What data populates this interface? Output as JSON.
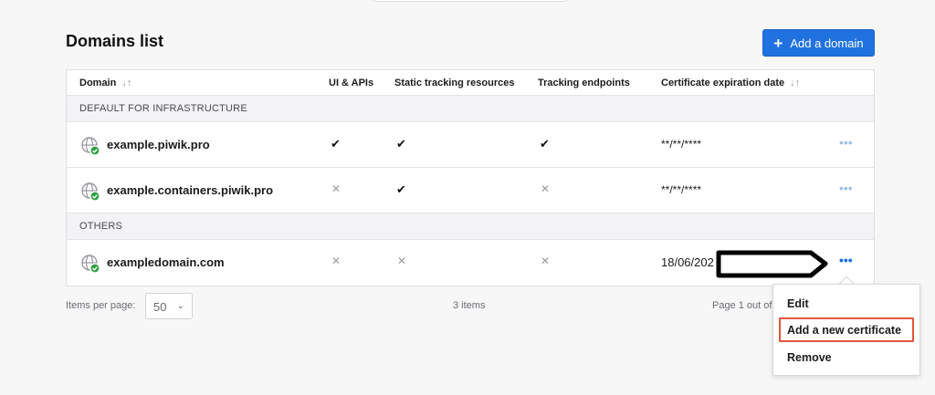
{
  "page": {
    "title": "Domains list"
  },
  "actions": {
    "add_domain_label": "Add a domain",
    "add_icon": "plus-icon"
  },
  "table": {
    "headers": {
      "domain": "Domain",
      "ui_apis": "UI & APIs",
      "static_tracking": "Static tracking resources",
      "tracking_endpoints": "Tracking endpoints",
      "cert_expiration": "Certificate expiration date",
      "sort_icon": "↓↑"
    },
    "sections": [
      {
        "label": "DEFAULT FOR INFRASTRUCTURE"
      },
      {
        "label": "OTHERS"
      }
    ],
    "rows": [
      {
        "domain": "example.piwik.pro",
        "ui_apis": "✔",
        "static": "✔",
        "endpoints": "✔",
        "cert": "**/**/****",
        "menu": "•••"
      },
      {
        "domain": "example.containers.piwik.pro",
        "ui_apis": "✕",
        "static": "✔",
        "endpoints": "✕",
        "cert": "**/**/****",
        "menu": "•••"
      },
      {
        "domain": "exampledomain.com",
        "ui_apis": "✕",
        "static": "✕",
        "endpoints": "✕",
        "cert": "18/06/202",
        "menu": "•••"
      }
    ]
  },
  "footer": {
    "items_per_page_label": "Items per page:",
    "items_per_page_value": "50",
    "items_count": "3 items",
    "page_info": "Page 1 out of"
  },
  "context_menu": {
    "items": [
      "Edit",
      "Add a new certificate",
      "Remove"
    ]
  },
  "colors": {
    "accent": "#1f72e0",
    "highlight": "#e2563b",
    "status_ok": "#2ea043"
  }
}
